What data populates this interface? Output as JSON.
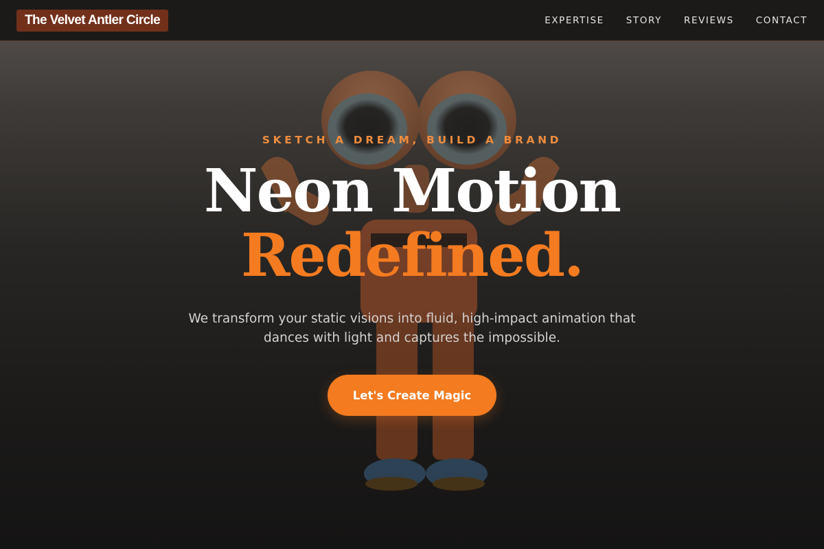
{
  "nav": {
    "brand": "The Velvet Antler Circle",
    "links": [
      {
        "label": "EXPERTISE"
      },
      {
        "label": "STORY"
      },
      {
        "label": "REVIEWS"
      },
      {
        "label": "CONTACT"
      }
    ]
  },
  "hero": {
    "eyebrow": "SKETCH A DREAM, BUILD A BRAND",
    "headline_line1": "Neon Motion",
    "headline_line2": "Redefined.",
    "subtitle": "We transform your static visions into fluid, high-impact animation that dances with light and captures the impossible.",
    "cta_label": "Let's Create Magic"
  },
  "colors": {
    "accent": "#f47b20",
    "brand_badge": "#72301b",
    "background": "#1b1a19"
  },
  "background_image": {
    "icon": "cartoon-character-illustration"
  }
}
